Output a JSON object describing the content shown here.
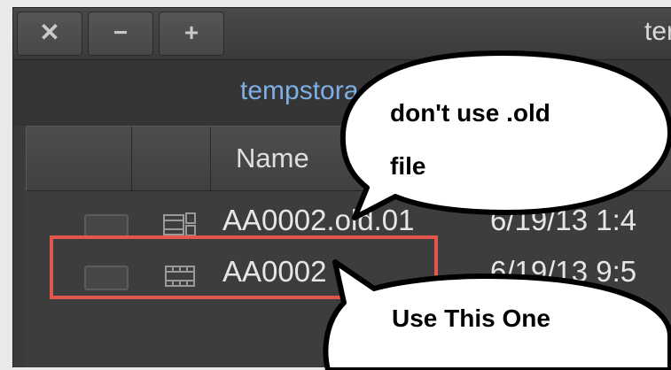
{
  "window": {
    "title": "ter",
    "close_glyph": "✕",
    "minimize_glyph": "−",
    "zoom_glyph": "+"
  },
  "pathbar": {
    "path": "tempstora",
    "right_fragment": "/"
  },
  "columns": {
    "name_header": "Name"
  },
  "files": [
    {
      "name": "AA0002.old.01",
      "date": "6/19/13 1:4",
      "icon": "sequence-icon"
    },
    {
      "name": "AA0002",
      "date": "6/19/13 9:5",
      "icon": "film-icon"
    }
  ],
  "callouts": {
    "top_line1": "don't use .old",
    "top_line2": "file",
    "bottom": "Use This One"
  },
  "colors": {
    "highlight": "#e2564d",
    "path_text": "#7eaee6"
  }
}
